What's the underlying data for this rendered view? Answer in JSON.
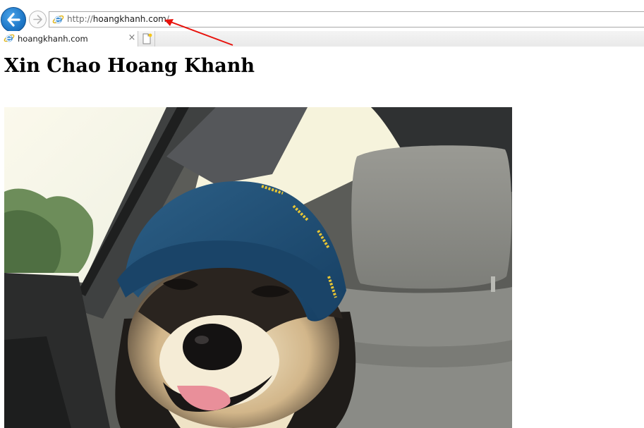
{
  "browser": {
    "address_bar": {
      "url_scheme": "http://",
      "url_host": "hoangkhanh.com",
      "url_path": "/"
    },
    "tabs": [
      {
        "title": "hoangkhanh.com",
        "close_glyph": "×",
        "icon": "ie-icon"
      }
    ],
    "new_tab_icon": "new-tab-icon",
    "accent_color": "#1e78c8",
    "annotation_arrow_color": "#e8120c"
  },
  "page": {
    "heading": "Xin Chao Hoang Khanh",
    "image": "photo of a dog wearing a blue cap in a car"
  }
}
